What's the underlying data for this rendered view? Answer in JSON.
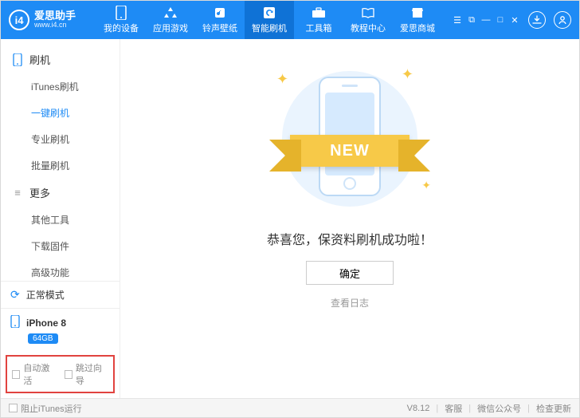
{
  "brand": {
    "logo_text": "i4",
    "title": "爱思助手",
    "url": "www.i4.cn"
  },
  "nav": {
    "items": [
      {
        "label": "我的设备"
      },
      {
        "label": "应用游戏"
      },
      {
        "label": "铃声壁纸"
      },
      {
        "label": "智能刷机"
      },
      {
        "label": "工具箱"
      },
      {
        "label": "教程中心"
      },
      {
        "label": "爱思商城"
      }
    ],
    "active_index": 3
  },
  "sidebar": {
    "groups": [
      {
        "title": "刷机",
        "items": [
          "iTunes刷机",
          "一键刷机",
          "专业刷机",
          "批量刷机"
        ],
        "active_index": 1
      },
      {
        "title": "更多",
        "items": [
          "其他工具",
          "下载固件",
          "高级功能"
        ],
        "active_index": -1
      }
    ],
    "status": {
      "text": "正常模式"
    },
    "device": {
      "name": "iPhone 8",
      "storage": "64GB"
    },
    "checks": {
      "auto_activate": "自动激活",
      "skip_setup": "跳过向导"
    }
  },
  "main": {
    "ribbon_text": "NEW",
    "message": "恭喜您，保资料刷机成功啦！",
    "ok_button": "确定",
    "log_link": "查看日志"
  },
  "footer": {
    "block_itunes": "阻止iTunes运行",
    "version": "V8.12",
    "links": {
      "service": "客服",
      "wechat": "微信公众号",
      "update": "检查更新"
    }
  }
}
